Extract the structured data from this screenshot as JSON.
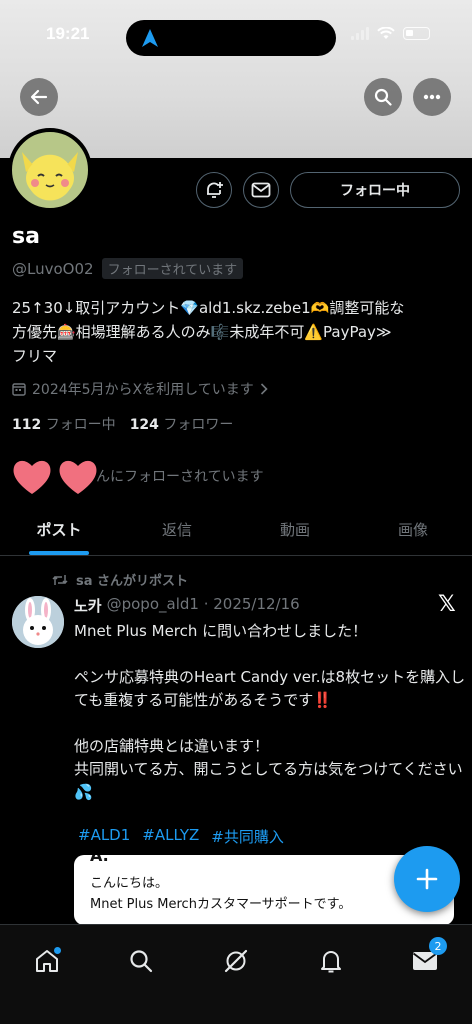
{
  "status": {
    "time": "19:21"
  },
  "profile": {
    "name": "sa",
    "handle": "@LuvoO02",
    "follows_you": "フォローされています",
    "follow_button": "フォロー中",
    "bio_lines": [
      "25↑30↓取引アカウント💎ald1.skz.zebe1🫶調整可能な",
      "方優先🎰相場理解ある人のみ🎼未成年不可⚠️PayPay≫",
      "フリマ"
    ],
    "joined": "2024年5月からXを利用しています",
    "following_count": "112",
    "following_label": "フォロー中",
    "followers_count": "124",
    "followers_label": "フォロワー",
    "mutual_text": "んにフォローされています"
  },
  "tabs": [
    "ポスト",
    "返信",
    "動画",
    "画像"
  ],
  "post": {
    "repost_label": "sa さんがリポスト",
    "author": "노카",
    "handle_date": "@popo_ald1 · 2025/12/16",
    "body": "Mnet Plus Merch に問い合わせしました！\n\nペンサ応募特典のHeart Candy ver.は8枚セットを購入しても重複する可能性があるそうです‼️\n\n他の店舗特典とは違います！\n共同開いてる方、開こうとしてる方は気をつけてください💦",
    "tags": [
      "#ALD1",
      "#ALLYZ",
      "#共同購入"
    ],
    "quote_cut": "A.",
    "quote_line1": "こんにちは。",
    "quote_line2": "Mnet Plus Merchカスタマーサポートです。"
  },
  "nav": {
    "messages_badge": "2"
  },
  "colors": {
    "accent": "#1d9bf0",
    "background": "#000000",
    "muted": "#71767b"
  }
}
